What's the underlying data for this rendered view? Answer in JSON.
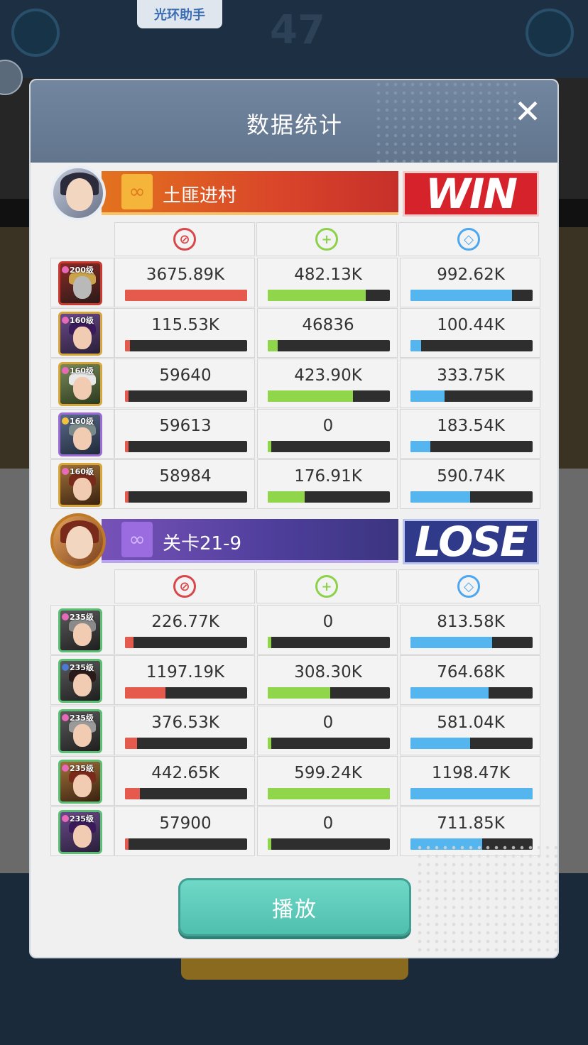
{
  "helper_button": "光环助手",
  "background_number": "47",
  "dialog": {
    "title": "数据统计",
    "close_label": "✕",
    "play_button": "播放"
  },
  "teams": [
    {
      "name": "土匪进村",
      "result": "WIN",
      "rows": [
        {
          "level": "200级",
          "damage": "3675.89K",
          "heal": "482.13K",
          "shield": "992.62K",
          "damage_frac": 1.0,
          "heal_frac": 0.8,
          "shield_frac": 0.83
        },
        {
          "level": "160级",
          "damage": "115.53K",
          "heal": "46836",
          "shield": "100.44K",
          "damage_frac": 0.04,
          "heal_frac": 0.08,
          "shield_frac": 0.09
        },
        {
          "level": "160级",
          "damage": "59640",
          "heal": "423.90K",
          "shield": "333.75K",
          "damage_frac": 0.02,
          "heal_frac": 0.7,
          "shield_frac": 0.28
        },
        {
          "level": "160级",
          "damage": "59613",
          "heal": "0",
          "shield": "183.54K",
          "damage_frac": 0.02,
          "heal_frac": 0.0,
          "shield_frac": 0.16
        },
        {
          "level": "160级",
          "damage": "58984",
          "heal": "176.91K",
          "shield": "590.74K",
          "damage_frac": 0.02,
          "heal_frac": 0.3,
          "shield_frac": 0.49
        }
      ]
    },
    {
      "name": "关卡21-9",
      "result": "LOSE",
      "rows": [
        {
          "level": "235级",
          "damage": "226.77K",
          "heal": "0",
          "shield": "813.58K",
          "damage_frac": 0.07,
          "heal_frac": 0.0,
          "shield_frac": 0.67
        },
        {
          "level": "235级",
          "damage": "1197.19K",
          "heal": "308.30K",
          "shield": "764.68K",
          "damage_frac": 0.33,
          "heal_frac": 0.51,
          "shield_frac": 0.64
        },
        {
          "level": "235级",
          "damage": "376.53K",
          "heal": "0",
          "shield": "581.04K",
          "damage_frac": 0.1,
          "heal_frac": 0.0,
          "shield_frac": 0.49
        },
        {
          "level": "235级",
          "damage": "442.65K",
          "heal": "599.24K",
          "shield": "1198.47K",
          "damage_frac": 0.12,
          "heal_frac": 1.0,
          "shield_frac": 1.0
        },
        {
          "level": "235级",
          "damage": "57900",
          "heal": "0",
          "shield": "711.85K",
          "damage_frac": 0.02,
          "heal_frac": 0.0,
          "shield_frac": 0.59
        }
      ]
    }
  ],
  "colors": {
    "damage": "#e55a4d",
    "heal": "#90d64b",
    "shield": "#55b5ef"
  },
  "icons": {
    "damage": "damage-icon",
    "heal": "heal-icon",
    "shield": "shield-icon"
  }
}
